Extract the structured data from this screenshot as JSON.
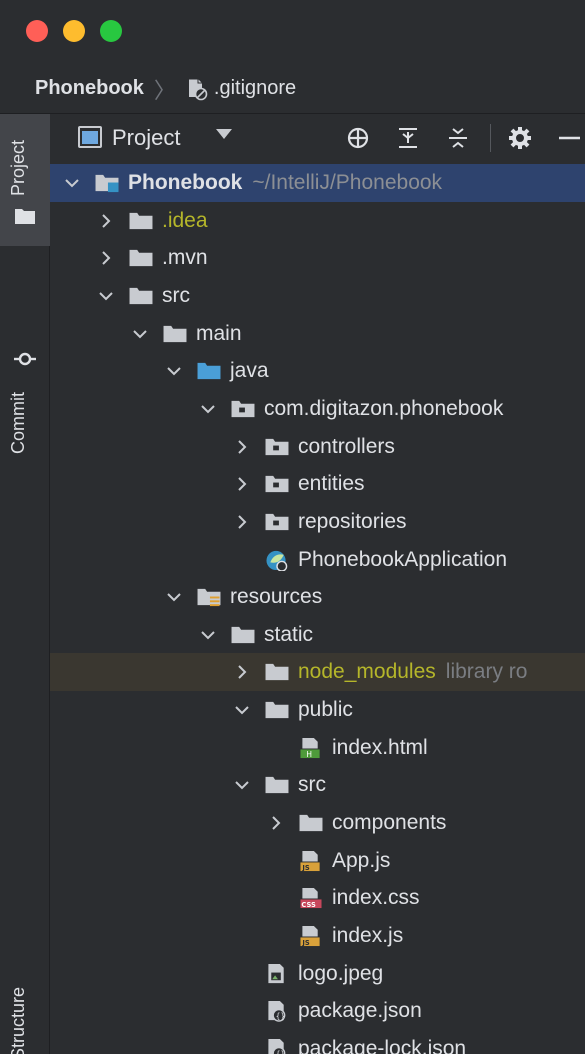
{
  "breadcrumb": {
    "root": "Phonebook",
    "file": ".gitignore"
  },
  "toolstrip": {
    "project": "Project",
    "commit": "Commit",
    "structure": "Structure"
  },
  "toolbar": {
    "view_label": "Project"
  },
  "colors": {
    "selection": "#2e436e",
    "excluded": "#b5b62a",
    "node_modules_bg": "#3a3730"
  },
  "tree": [
    {
      "label": "Phonebook",
      "hint": "~/IntelliJ/Phonebook",
      "depth": 0,
      "arrow": "down",
      "icon": "module-folder-icon",
      "bold": true,
      "selected": true
    },
    {
      "label": ".idea",
      "depth": 1,
      "arrow": "right",
      "icon": "folder-icon",
      "yellow": true
    },
    {
      "label": ".mvn",
      "depth": 1,
      "arrow": "right",
      "icon": "folder-icon"
    },
    {
      "label": "src",
      "depth": 1,
      "arrow": "down",
      "icon": "folder-icon"
    },
    {
      "label": "main",
      "depth": 2,
      "arrow": "down",
      "icon": "folder-icon"
    },
    {
      "label": "java",
      "depth": 3,
      "arrow": "down",
      "icon": "source-folder-icon"
    },
    {
      "label": "com.digitazon.phonebook",
      "depth": 4,
      "arrow": "down",
      "icon": "package-icon"
    },
    {
      "label": "controllers",
      "depth": 5,
      "arrow": "right",
      "icon": "package-icon"
    },
    {
      "label": "entities",
      "depth": 5,
      "arrow": "right",
      "icon": "package-icon"
    },
    {
      "label": "repositories",
      "depth": 5,
      "arrow": "right",
      "icon": "package-icon"
    },
    {
      "label": "PhonebookApplication",
      "depth": 5,
      "arrow": "none",
      "icon": "spring-app-icon"
    },
    {
      "label": "resources",
      "depth": 3,
      "arrow": "down",
      "icon": "resources-folder-icon"
    },
    {
      "label": "static",
      "depth": 4,
      "arrow": "down",
      "icon": "folder-icon"
    },
    {
      "label": "node_modules",
      "hint": "library ro",
      "depth": 5,
      "arrow": "right",
      "icon": "folder-icon",
      "yellow": true,
      "highlight": true
    },
    {
      "label": "public",
      "depth": 5,
      "arrow": "down",
      "icon": "folder-icon"
    },
    {
      "label": "index.html",
      "depth": 6,
      "arrow": "none",
      "icon": "html-file-icon"
    },
    {
      "label": "src",
      "depth": 5,
      "arrow": "down",
      "icon": "folder-icon"
    },
    {
      "label": "components",
      "depth": 6,
      "arrow": "right",
      "icon": "folder-icon"
    },
    {
      "label": "App.js",
      "depth": 6,
      "arrow": "none",
      "icon": "js-file-icon"
    },
    {
      "label": "index.css",
      "depth": 6,
      "arrow": "none",
      "icon": "css-file-icon"
    },
    {
      "label": "index.js",
      "depth": 6,
      "arrow": "none",
      "icon": "js-file-icon"
    },
    {
      "label": "logo.jpeg",
      "depth": 5,
      "arrow": "none",
      "icon": "image-file-icon"
    },
    {
      "label": "package.json",
      "depth": 5,
      "arrow": "none",
      "icon": "json-file-icon"
    },
    {
      "label": "package-lock.json",
      "depth": 5,
      "arrow": "none",
      "icon": "json-file-icon"
    }
  ]
}
